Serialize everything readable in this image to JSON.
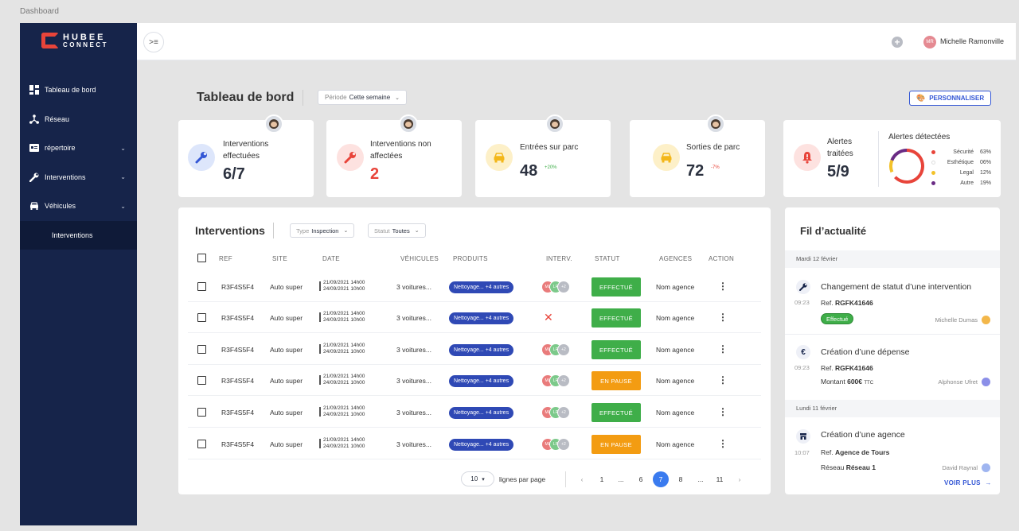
{
  "window": {
    "title": "Dashboard"
  },
  "logo": {
    "line1": "HUBEE",
    "line2": "CONNECT"
  },
  "sidebar": {
    "items": [
      {
        "label": "Tableau de bord",
        "icon": "dashboard-icon",
        "has_chevron": false
      },
      {
        "label": "Réseau",
        "icon": "network-icon",
        "has_chevron": false
      },
      {
        "label": "répertoire",
        "icon": "directory-icon",
        "has_chevron": true
      },
      {
        "label": "Interventions",
        "icon": "wrench-icon",
        "has_chevron": true
      },
      {
        "label": "Véhicules",
        "icon": "car-icon",
        "has_chevron": true
      }
    ],
    "subitem": "Interventions"
  },
  "topbar": {
    "user_initials": "MR",
    "user_name": "Michelle Ramonville"
  },
  "header": {
    "title": "Tableau de bord",
    "period_label": "Période",
    "period_value": "Cette semaine",
    "customize": "PERSONNALISER"
  },
  "kpis": {
    "k1": {
      "label1": "Interventions",
      "label2": "effectuées",
      "value": "6/7"
    },
    "k2": {
      "label1": "Interventions  non",
      "label2": "affectées",
      "value": "2"
    },
    "k3": {
      "label1": "Entrées sur parc",
      "value": "48",
      "delta": "+20%"
    },
    "k4": {
      "label1": "Sorties de parc",
      "value": "72",
      "delta": "-7%"
    },
    "k5": {
      "label1": "Alertes",
      "label2": "traitées",
      "value": "5/9"
    }
  },
  "alerts": {
    "title": "Alertes détectées",
    "items": [
      {
        "name": "Sécurité",
        "pct": "63%",
        "value": 63,
        "color": "#e8443a"
      },
      {
        "name": "Esthétique",
        "pct": "06%",
        "value": 6,
        "color": "#ffffff"
      },
      {
        "name": "Legal",
        "pct": "12%",
        "value": 12,
        "color": "#f3c22a"
      },
      {
        "name": "Autre",
        "pct": "19%",
        "value": 19,
        "color": "#6a2b84"
      }
    ]
  },
  "interventions": {
    "title": "Interventions",
    "filter_type_label": "Type",
    "filter_type_value": "Inspection",
    "filter_status_label": "Statut",
    "filter_status_value": "Toutes",
    "columns": [
      "REF",
      "SITE",
      "DATE",
      "VÉHICULES",
      "PRODUITS",
      "INTERV.",
      "STATUT",
      "AGENCES",
      "ACTION"
    ],
    "rows": [
      {
        "ref": "R3F4S5F4",
        "site": "Auto super",
        "date1": "21/09/2021 14h00",
        "date2": "24/09/2021 10h00",
        "vehicles": "3 voitures...",
        "products": "Nettoyage... +4 autres",
        "interv": [
          "ML",
          "LR",
          "+2"
        ],
        "status": "EFFECTUÉ",
        "status_color": "#3fae49",
        "agency": "Nom agence"
      },
      {
        "ref": "R3F4S5F4",
        "site": "Auto super",
        "date1": "21/09/2021 14h00",
        "date2": "24/09/2021 10h00",
        "vehicles": "3 voitures...",
        "products": "Nettoyage... +4 autres",
        "interv": [],
        "status": "EFFECTUÉ",
        "status_color": "#3fae49",
        "agency": "Nom agence"
      },
      {
        "ref": "R3F4S5F4",
        "site": "Auto super",
        "date1": "21/09/2021 14h00",
        "date2": "24/09/2021 10h00",
        "vehicles": "3 voitures...",
        "products": "Nettoyage... +4 autres",
        "interv": [
          "ML",
          "LR",
          "+2"
        ],
        "status": "EFFECTUÉ",
        "status_color": "#3fae49",
        "agency": "Nom agence"
      },
      {
        "ref": "R3F4S5F4",
        "site": "Auto super",
        "date1": "21/09/2021 14h00",
        "date2": "24/09/2021 10h00",
        "vehicles": "3 voitures...",
        "products": "Nettoyage... +4 autres",
        "interv": [
          "ML",
          "LR",
          "+2"
        ],
        "status": "EN PAUSE",
        "status_color": "#f39c12",
        "agency": "Nom agence"
      },
      {
        "ref": "R3F4S5F4",
        "site": "Auto super",
        "date1": "21/09/2021 14h00",
        "date2": "24/09/2021 10h00",
        "vehicles": "3 voitures...",
        "products": "Nettoyage... +4 autres",
        "interv": [
          "ML",
          "LR",
          "+2"
        ],
        "status": "EFFECTUÉ",
        "status_color": "#3fae49",
        "agency": "Nom agence"
      },
      {
        "ref": "R3F4S5F4",
        "site": "Auto super",
        "date1": "21/09/2021 14h00",
        "date2": "24/09/2021 10h00",
        "vehicles": "3 voitures...",
        "products": "Nettoyage... +4 autres",
        "interv": [
          "ML",
          "LR",
          "+2"
        ],
        "status": "EN PAUSE",
        "status_color": "#f39c12",
        "agency": "Nom agence"
      }
    ],
    "rows_per_page": "10",
    "rows_per_page_label": "lignes par page",
    "pages": [
      "‹",
      "1",
      "...",
      "6",
      "7",
      "8",
      "...",
      "11",
      "›"
    ],
    "current_page": "7"
  },
  "feed": {
    "title": "Fil d’actualité",
    "day1": "Mardi 12 février",
    "day2": "Lundi 11 février",
    "e1": {
      "title": "Changement de statut d’une intervention",
      "time": "09:23",
      "ref_label": "Ref.",
      "ref": "RGFK41646",
      "badge": "Effectué",
      "user": "Michelle Dumas"
    },
    "e2": {
      "title": "Création d’une dépense",
      "time": "09:23",
      "ref_label": "Ref.",
      "ref": "RGFK41646",
      "amount_label": "Montant",
      "amount": "600€",
      "amount_suffix": "TTC",
      "user": "Alphonse Ufret"
    },
    "e3": {
      "title": "Création d’une agence",
      "time": "10:07",
      "ref_label": "Ref.",
      "ref": "Agence de Tours",
      "network_label": "Réseau",
      "network": "Réseau 1",
      "user": "David Raynal"
    },
    "more": "VOIR PLUS"
  }
}
